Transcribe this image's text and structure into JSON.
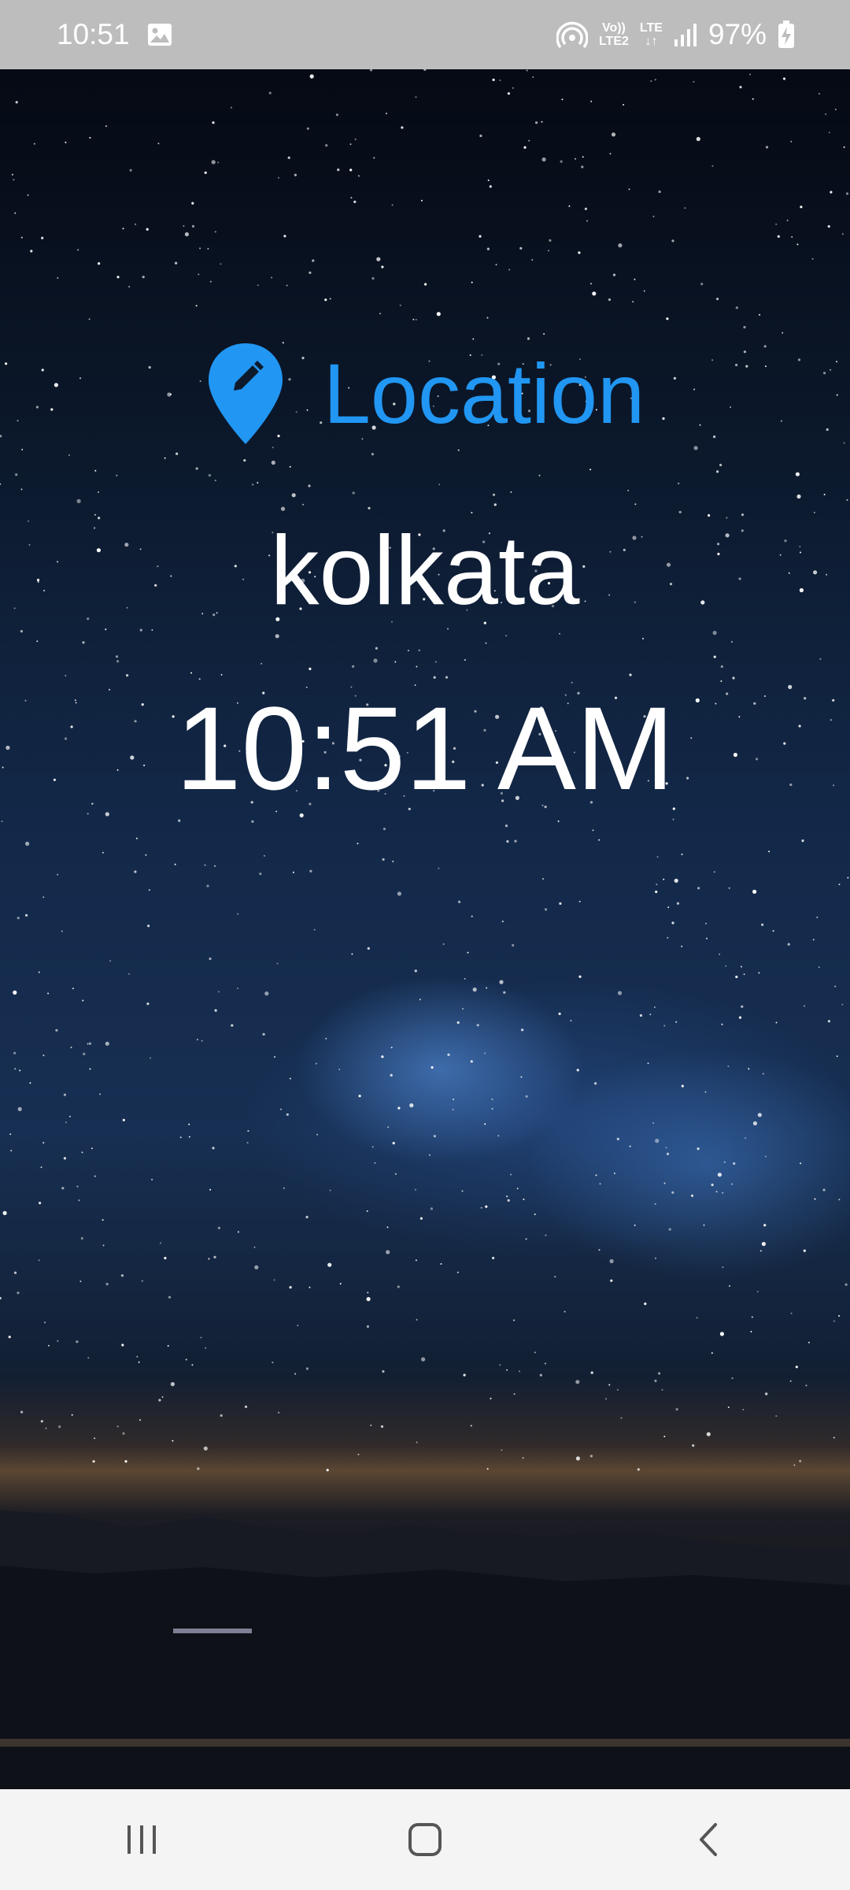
{
  "status_bar": {
    "time": "10:51",
    "network_top": "Vo))",
    "network_bottom": "LTE2",
    "lte_top": "LTE",
    "lte_bottom": "↓↑",
    "battery": "97%"
  },
  "main": {
    "location_label": "Location",
    "city": "kolkata",
    "time": "10:51 AM"
  },
  "icons": {
    "location": "location-pin-edit-icon",
    "gallery": "image-icon",
    "hotspot": "wifi-hotspot-icon",
    "signal": "signal-bars-icon",
    "battery": "battery-charging-icon",
    "recents": "recent-apps-icon",
    "home": "home-icon",
    "back": "back-icon"
  },
  "colors": {
    "accent": "#2196f3",
    "text": "#ffffff",
    "status_bar": "#bdbdbd",
    "nav_bar": "#f4f4f4"
  }
}
